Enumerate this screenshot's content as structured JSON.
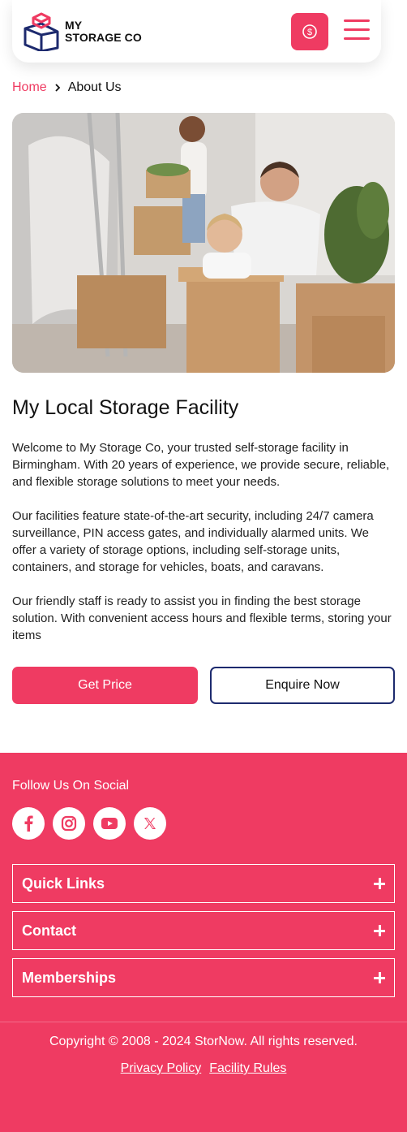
{
  "header": {
    "logo_line1": "MY",
    "logo_line2": "STORAGE CO",
    "price_icon": "dollar-circle-icon",
    "menu_icon": "hamburger-icon"
  },
  "breadcrumb": {
    "home": "Home",
    "current": "About Us"
  },
  "hero": {
    "image": "family-moving-boxes-photo"
  },
  "main": {
    "title": "My Local Storage Facility",
    "paragraphs": [
      "Welcome to My Storage Co, your trusted self-storage facility in Birmingham. With 20 years of experience, we provide secure, reliable, and flexible storage solutions to meet your needs.",
      "Our facilities feature state-of-the-art security, including 24/7 camera surveillance, PIN access gates, and individually alarmed units. We offer a variety of storage options, including self-storage units, containers, and storage for vehicles, boats, and caravans.",
      "Our friendly staff is ready to assist you in finding the best storage solution. With convenient access hours and flexible terms, storing your items"
    ],
    "primary_button": "Get Price",
    "secondary_button": "Enquire Now"
  },
  "footer": {
    "follow_label": "Follow Us On Social",
    "socials": [
      "facebook-icon",
      "instagram-icon",
      "youtube-icon",
      "x-icon"
    ],
    "accordions": [
      "Quick Links",
      "Contact",
      "Memberships"
    ],
    "copyright": "Copyright © 2008 - 2024 StorNow. All rights reserved.",
    "links": [
      "Privacy Policy",
      "Facility Rules"
    ]
  },
  "colors": {
    "accent": "#ef3b62",
    "navy": "#1d2a6e"
  }
}
